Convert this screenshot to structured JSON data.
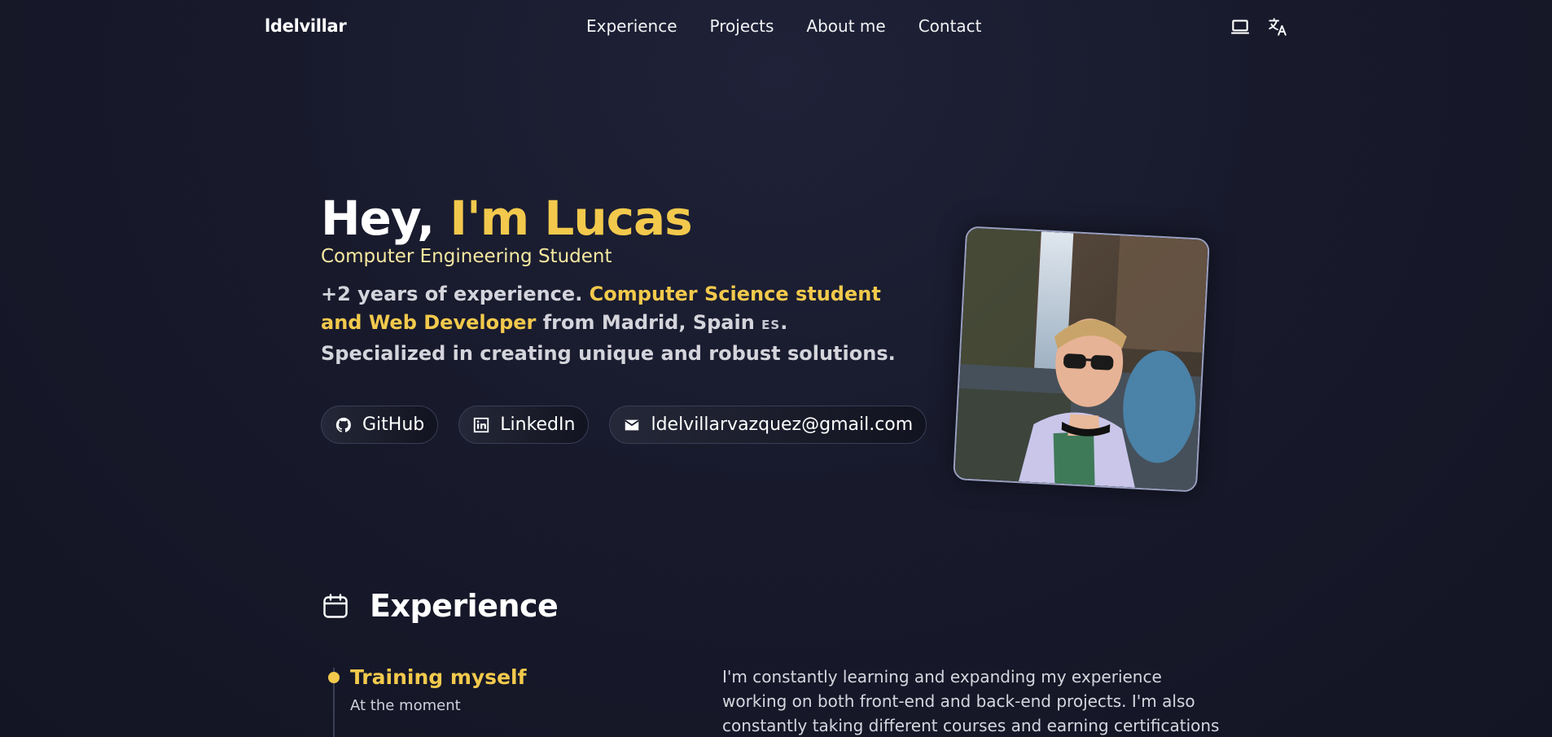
{
  "nav": {
    "brand": "ldelvillar",
    "links": [
      "Experience",
      "Projects",
      "About me",
      "Contact"
    ],
    "tools": [
      "laptop-icon",
      "translate-icon"
    ]
  },
  "hero": {
    "greeting": "Hey,",
    "name": "I'm Lucas",
    "subtitle": "Computer Engineering Student",
    "intro_start": "+2 years of experience.",
    "intro_highlight": "Computer Science student and Web Developer",
    "intro_mid": "from Madrid, Spain",
    "intro_flag": "ES",
    "intro_end": ". Specialized in creating unique and robust solutions.",
    "links": {
      "github": "GitHub",
      "linkedin": "LinkedIn",
      "email": "ldelvillarvazquez@gmail.com"
    }
  },
  "experience": {
    "title": "Experience",
    "items": [
      {
        "title": "Training myself",
        "date": "At the moment",
        "description": "I'm constantly learning and expanding my experience working on both front-end and back-end projects. I'm also constantly taking different courses and earning certifications in various topics such"
      }
    ]
  },
  "colors": {
    "accent": "#f2c94c",
    "background": "#181a2c",
    "text": "#e8e8ee"
  }
}
